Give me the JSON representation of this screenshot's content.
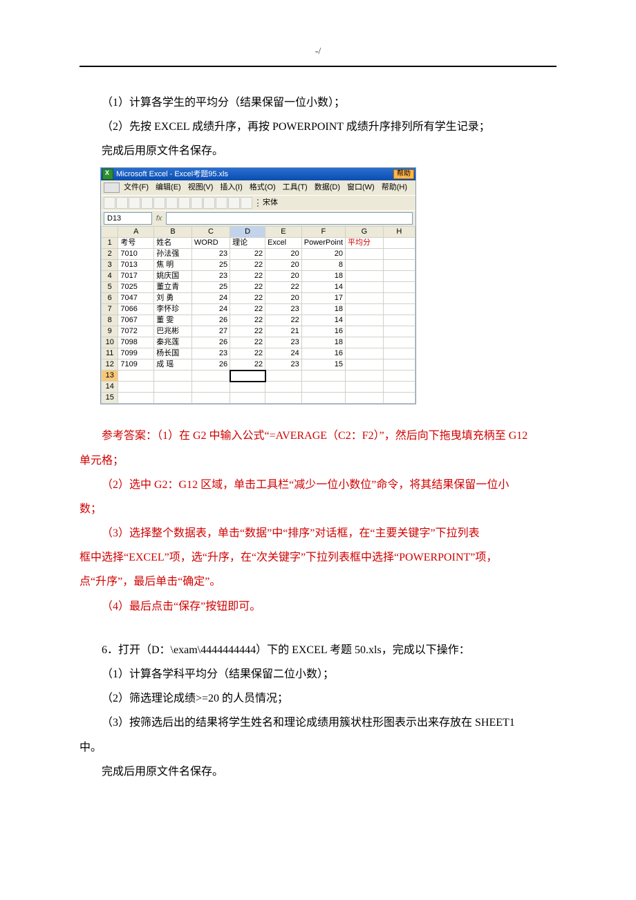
{
  "header": "-/",
  "intro": {
    "line1": "（1）计算各学生的平均分（结果保留一位小数）；",
    "line2": "（2）先按 EXCEL 成绩升序，再按 POWERPOINT 成绩升序排列所有学生记录；",
    "line3": "完成后用原文件名保存。"
  },
  "excel": {
    "title": "Microsoft Excel - Excel考题95.xls",
    "help": "帮助",
    "menus": [
      "文件(F)",
      "编辑(E)",
      "视图(V)",
      "插入(I)",
      "格式(O)",
      "工具(T)",
      "数据(D)",
      "窗口(W)",
      "帮助(H)"
    ],
    "font": "宋体",
    "namebox": "D13",
    "fx": "fx",
    "cols": [
      "A",
      "B",
      "C",
      "D",
      "E",
      "F",
      "G",
      "H"
    ],
    "hrow": [
      "考号",
      "姓名",
      "WORD",
      "理论",
      "Excel",
      "PowerPoint",
      "平均分",
      ""
    ],
    "rows": [
      [
        "7010",
        "孙法强",
        "23",
        "22",
        "20",
        "20",
        "",
        ""
      ],
      [
        "7013",
        "焦  明",
        "25",
        "22",
        "20",
        "8",
        "",
        ""
      ],
      [
        "7017",
        "姚庆国",
        "23",
        "22",
        "20",
        "18",
        "",
        ""
      ],
      [
        "7025",
        "董立青",
        "25",
        "22",
        "22",
        "14",
        "",
        ""
      ],
      [
        "7047",
        "刘  勇",
        "24",
        "22",
        "20",
        "17",
        "",
        ""
      ],
      [
        "7066",
        "李怀珍",
        "24",
        "22",
        "23",
        "18",
        "",
        ""
      ],
      [
        "7067",
        "董  雯",
        "26",
        "22",
        "22",
        "14",
        "",
        ""
      ],
      [
        "7072",
        "巴兆彬",
        "27",
        "22",
        "21",
        "16",
        "",
        ""
      ],
      [
        "7098",
        "秦兆莲",
        "26",
        "22",
        "23",
        "18",
        "",
        ""
      ],
      [
        "7099",
        "杨长国",
        "23",
        "22",
        "24",
        "16",
        "",
        ""
      ],
      [
        "7109",
        "成  瑶",
        "26",
        "22",
        "23",
        "15",
        "",
        ""
      ]
    ]
  },
  "answers": {
    "a1": "参考答案：（1）在 G2 中输入公式“=AVERAGE（C2：F2）”，然后向下拖曳填充柄至 G12",
    "a1b": "单元格；",
    "a2": "（2）选中 G2：G12 区域，单击工具栏“减少一位小数位”命令，将其结果保留一位小",
    "a2b": "数；",
    "a3": "（3）选择整个数据表，单击“数据”中“排序”对话框，在“主要关键字”下拉列表",
    "a3b": "框中选择“EXCEL”项，选“升序，在“次关键字”下拉列表框中选择“POWERPOINT”项，",
    "a3c": "点“升序”，最后单击“确定”。",
    "a4": "（4）最后点击“保存”按钮即可。"
  },
  "q6": {
    "title": "6．打开（D：\\exam\\4444444444）下的 EXCEL 考题 50.xls，完成以下操作：",
    "l1": "（1）计算各学科平均分（结果保留二位小数）；",
    "l2": "（2）筛选理论成绩>=20 的人员情况；",
    "l3": "（3）按筛选后出的结果将学生姓名和理论成绩用簇状柱形图表示出来存放在 SHEET1",
    "l3b": "中。",
    "l4": "完成后用原文件名保存。"
  },
  "chart_data": {
    "type": "table",
    "title": "Excel考题95.xls 数据",
    "columns": [
      "考号",
      "姓名",
      "WORD",
      "理论",
      "Excel",
      "PowerPoint",
      "平均分"
    ],
    "rows": [
      [
        "7010",
        "孙法强",
        23,
        22,
        20,
        20,
        null
      ],
      [
        "7013",
        "焦明",
        25,
        22,
        20,
        8,
        null
      ],
      [
        "7017",
        "姚庆国",
        23,
        22,
        20,
        18,
        null
      ],
      [
        "7025",
        "董立青",
        25,
        22,
        22,
        14,
        null
      ],
      [
        "7047",
        "刘勇",
        24,
        22,
        20,
        17,
        null
      ],
      [
        "7066",
        "李怀珍",
        24,
        22,
        23,
        18,
        null
      ],
      [
        "7067",
        "董雯",
        26,
        22,
        22,
        14,
        null
      ],
      [
        "7072",
        "巴兆彬",
        27,
        22,
        21,
        16,
        null
      ],
      [
        "7098",
        "秦兆莲",
        26,
        22,
        23,
        18,
        null
      ],
      [
        "7099",
        "杨长国",
        23,
        22,
        24,
        16,
        null
      ],
      [
        "7109",
        "成瑶",
        26,
        22,
        23,
        15,
        null
      ]
    ]
  }
}
